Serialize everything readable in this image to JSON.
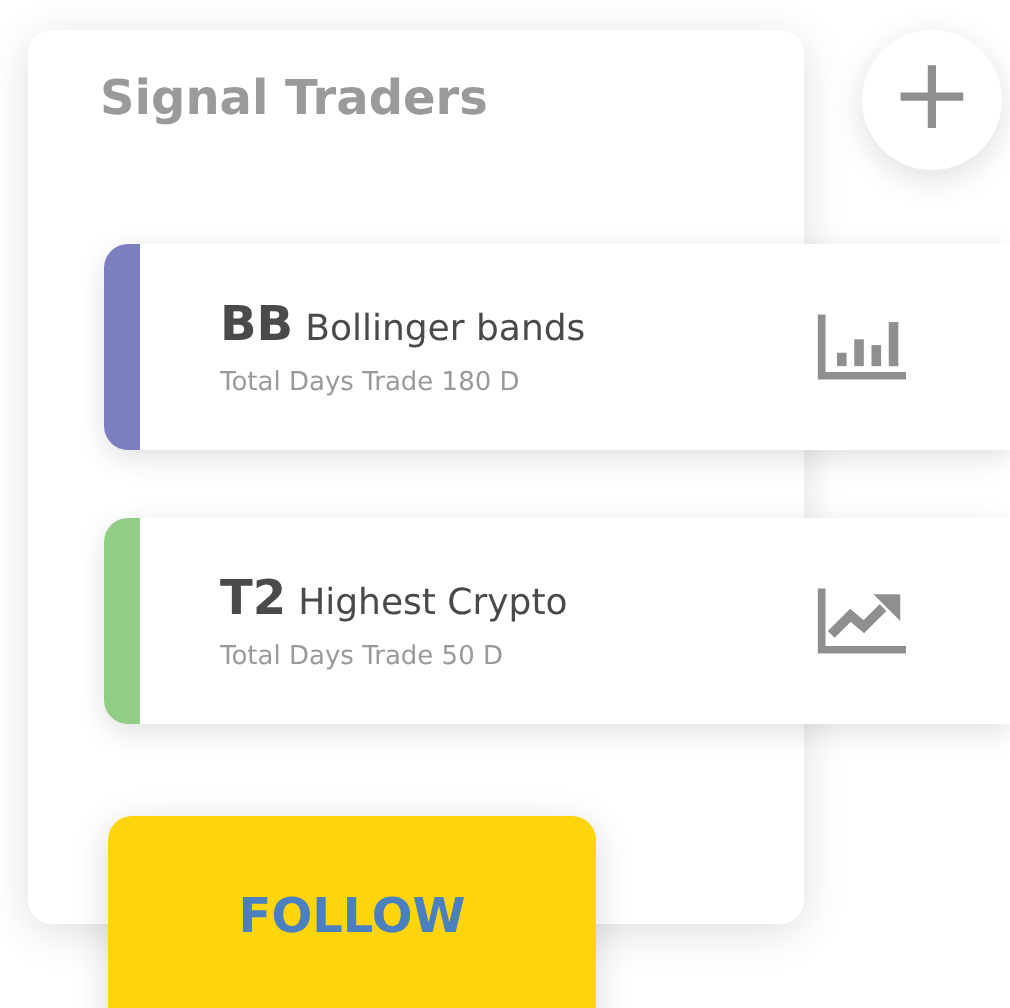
{
  "panel": {
    "title": "Signal Traders"
  },
  "add_button": {
    "label": "+"
  },
  "traders": [
    {
      "code": "BB",
      "name": "Bollinger bands",
      "detail": "Total Days Trade 180 D",
      "color": "#7b7fbf",
      "kind": "bars"
    },
    {
      "code": "T2",
      "name": "Highest Crypto",
      "detail": "Total Days Trade 50 D",
      "color": "#92cd86",
      "kind": "trend"
    }
  ],
  "follow_button": {
    "label": "FOLLOW"
  }
}
